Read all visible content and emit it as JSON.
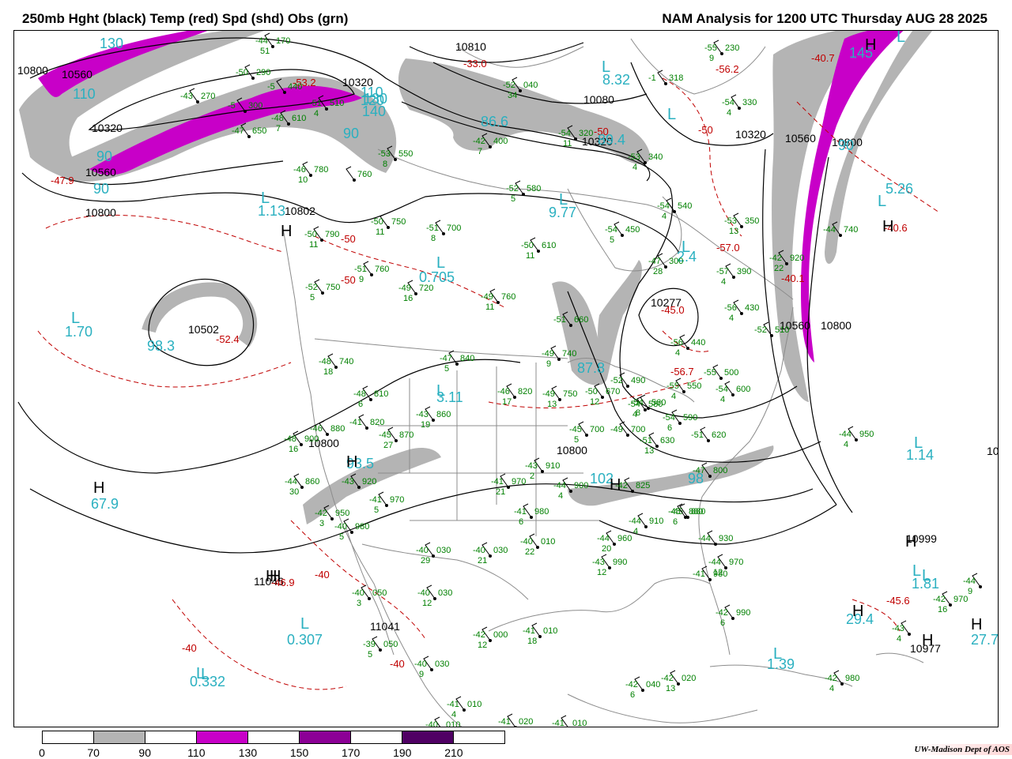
{
  "header": {
    "left_title": "250mb Hght (black) Temp (red) Spd (shd) Obs (grn)",
    "right_title": "NAM Analysis for 1200 UTC Thursday  AUG 28 2025"
  },
  "colors": {
    "height": "#000000",
    "temp": "#c00000",
    "obs": "#008000",
    "speed_label": "#2ab0c0",
    "shade_70": "#b4b4b4",
    "shade_110": "#c800c8",
    "shade_150": "#8c0096",
    "shade_190": "#500064",
    "map_lines": "#8c8c8c"
  },
  "colorbar": {
    "ticks": [
      "0",
      "70",
      "90",
      "110",
      "130",
      "150",
      "170",
      "190",
      "210"
    ],
    "fills": [
      "#ffffff",
      "#b4b4b4",
      "#ffffff",
      "#c800c8",
      "#ffffff",
      "#8c0096",
      "#ffffff",
      "#500064",
      "#ffffff"
    ]
  },
  "credit": "UW-Madison  Dept of AOS",
  "height_labels": [
    {
      "text": "10800",
      "name": "height-10800-nw"
    },
    {
      "text": "10560",
      "name": "height-10560-nw"
    },
    {
      "text": "10320",
      "name": "height-10320-nw"
    },
    {
      "text": "10560",
      "name": "height-10560-west"
    },
    {
      "text": "10800",
      "name": "height-10800-west"
    },
    {
      "text": "10320",
      "name": "height-10320-bc"
    },
    {
      "text": "10802",
      "name": "height-10802"
    },
    {
      "text": "10502",
      "name": "height-10502-low"
    },
    {
      "text": "10800",
      "name": "height-10800-sw"
    },
    {
      "text": "11046",
      "name": "height-11046"
    },
    {
      "text": "11041",
      "name": "height-11041"
    },
    {
      "text": "10810",
      "name": "height-10810-arctic"
    },
    {
      "text": "10080",
      "name": "height-10080-hudson"
    },
    {
      "text": "10320",
      "name": "height-10320-hudson"
    },
    {
      "text": "10277",
      "name": "height-10277"
    },
    {
      "text": "10560",
      "name": "height-10560-ne"
    },
    {
      "text": "10800",
      "name": "height-10800-ne"
    },
    {
      "text": "10320",
      "name": "height-10320-ne"
    },
    {
      "text": "10560",
      "name": "height-10560-atl"
    },
    {
      "text": "10800",
      "name": "height-10800-atl"
    },
    {
      "text": "10800",
      "name": "height-10800-ohio"
    },
    {
      "text": "10999",
      "name": "height-10999"
    },
    {
      "text": "10977",
      "name": "height-10977"
    },
    {
      "text": "10",
      "name": "height-10-edge"
    }
  ],
  "temp_labels": [
    {
      "text": "-47.9"
    },
    {
      "text": "-53.2"
    },
    {
      "text": "-50"
    },
    {
      "text": "-50"
    },
    {
      "text": "-52.4"
    },
    {
      "text": "-33.0"
    },
    {
      "text": "-50"
    },
    {
      "text": "-56.2"
    },
    {
      "text": "-40.7"
    },
    {
      "text": "-50"
    },
    {
      "text": "-40.6"
    },
    {
      "text": "-57.0"
    },
    {
      "text": "-40.1"
    },
    {
      "text": "-45.0"
    },
    {
      "text": "-56.7"
    },
    {
      "text": "-40"
    },
    {
      "text": "-40"
    },
    {
      "text": "-46.9"
    },
    {
      "text": "-40"
    },
    {
      "text": "-45.6"
    }
  ],
  "speed_labels": [
    {
      "text": "130"
    },
    {
      "text": "110"
    },
    {
      "text": "90"
    },
    {
      "text": "90"
    },
    {
      "text": "130"
    },
    {
      "text": "90"
    },
    {
      "text": "110"
    },
    {
      "text": "120"
    },
    {
      "text": "86.6"
    },
    {
      "text": "89.4"
    },
    {
      "text": "8.32"
    },
    {
      "text": "1.13"
    },
    {
      "text": "9.77"
    },
    {
      "text": "0.705"
    },
    {
      "text": "1.70"
    },
    {
      "text": "98.3"
    },
    {
      "text": "3.11"
    },
    {
      "text": "87.8"
    },
    {
      "text": "2.4"
    },
    {
      "text": "93.5"
    },
    {
      "text": "67.9"
    },
    {
      "text": "102"
    },
    {
      "text": "98"
    },
    {
      "text": "145"
    },
    {
      "text": "5.26"
    },
    {
      "text": "1.14"
    },
    {
      "text": "1.81"
    },
    {
      "text": "29.4"
    },
    {
      "text": "27.7"
    },
    {
      "text": "0.307"
    },
    {
      "text": "0.332"
    },
    {
      "text": "1.39"
    },
    {
      "text": "90"
    },
    {
      "text": "140"
    }
  ],
  "pressure_letters": [
    {
      "text": "L"
    },
    {
      "text": "L"
    },
    {
      "text": "L"
    },
    {
      "text": "L"
    },
    {
      "text": "L"
    },
    {
      "text": "L"
    },
    {
      "text": "H"
    },
    {
      "text": "L"
    },
    {
      "text": "H"
    },
    {
      "text": "L"
    },
    {
      "text": "L"
    },
    {
      "text": "L"
    },
    {
      "text": "H"
    },
    {
      "text": "H"
    },
    {
      "text": "L"
    },
    {
      "text": "H"
    },
    {
      "text": "H"
    },
    {
      "text": "H"
    },
    {
      "text": "H"
    },
    {
      "text": "L"
    },
    {
      "text": "H"
    },
    {
      "text": "L"
    },
    {
      "text": "L"
    },
    {
      "text": "L"
    },
    {
      "text": "H"
    },
    {
      "text": "H"
    },
    {
      "text": "H"
    },
    {
      "text": "L"
    },
    {
      "text": "L"
    }
  ],
  "observations": [
    {
      "temp": "-44",
      "hgt": "170",
      "dew": "51"
    },
    {
      "temp": "-50",
      "hgt": "290",
      "dew": ""
    },
    {
      "temp": "-43",
      "hgt": "270",
      "dew": ""
    },
    {
      "temp": "-5",
      "hgt": "300",
      "dew": ""
    },
    {
      "temp": "-5",
      "hgt": "440",
      "dew": ""
    },
    {
      "temp": "-51",
      "hgt": "510",
      "dew": "4"
    },
    {
      "temp": "-48",
      "hgt": "610",
      "dew": "7"
    },
    {
      "temp": "-47",
      "hgt": "650",
      "dew": ""
    },
    {
      "temp": "-53",
      "hgt": "550",
      "dew": "8"
    },
    {
      "temp": "-46",
      "hgt": "780",
      "dew": "10"
    },
    {
      "temp": "",
      "hgt": "760",
      "dew": ""
    },
    {
      "temp": "-50",
      "hgt": "750",
      "dew": "11"
    },
    {
      "temp": "-51",
      "hgt": "700",
      "dew": "8"
    },
    {
      "temp": "-50",
      "hgt": "790",
      "dew": "11"
    },
    {
      "temp": "-51",
      "hgt": "760",
      "dew": "9"
    },
    {
      "temp": "-49",
      "hgt": "720",
      "dew": "16"
    },
    {
      "temp": "-52",
      "hgt": "750",
      "dew": "5"
    },
    {
      "temp": "-52",
      "hgt": "580",
      "dew": "5"
    },
    {
      "temp": "-50",
      "hgt": "610",
      "dew": "11"
    },
    {
      "temp": "-49",
      "hgt": "760",
      "dew": "11"
    },
    {
      "temp": "-51",
      "hgt": "660",
      "dew": ""
    },
    {
      "temp": "-49",
      "hgt": "740",
      "dew": "9"
    },
    {
      "temp": "-47",
      "hgt": "840",
      "dew": "5"
    },
    {
      "temp": "-48",
      "hgt": "740",
      "dew": "18"
    },
    {
      "temp": "-48",
      "hgt": "810",
      "dew": "6"
    },
    {
      "temp": "-46",
      "hgt": "820",
      "dew": "17"
    },
    {
      "temp": "-49",
      "hgt": "750",
      "dew": "13"
    },
    {
      "temp": "-50",
      "hgt": "670",
      "dew": "12"
    },
    {
      "temp": "-52",
      "hgt": "490",
      "dew": ""
    },
    {
      "temp": "-54",
      "hgt": "580",
      "dew": "4"
    },
    {
      "temp": "-43",
      "hgt": "860",
      "dew": "19"
    },
    {
      "temp": "-41",
      "hgt": "820",
      "dew": ""
    },
    {
      "temp": "-46",
      "hgt": "880",
      "dew": ""
    },
    {
      "temp": "-45",
      "hgt": "870",
      "dew": "27"
    },
    {
      "temp": "-48",
      "hgt": "900",
      "dew": "16"
    },
    {
      "temp": "-44",
      "hgt": "860",
      "dew": "30"
    },
    {
      "temp": "-43",
      "hgt": "920",
      "dew": ""
    },
    {
      "temp": "-41",
      "hgt": "970",
      "dew": "5"
    },
    {
      "temp": "-42",
      "hgt": "950",
      "dew": "3"
    },
    {
      "temp": "-40",
      "hgt": "980",
      "dew": "5"
    },
    {
      "temp": "-41",
      "hgt": "970",
      "dew": "21"
    },
    {
      "temp": "-43",
      "hgt": "910",
      "dew": "2"
    },
    {
      "temp": "-44",
      "hgt": "900",
      "dew": "4"
    },
    {
      "temp": "-45",
      "hgt": "700",
      "dew": "5"
    },
    {
      "temp": "-41",
      "hgt": "980",
      "dew": "6"
    },
    {
      "temp": "-40",
      "hgt": "030",
      "dew": "29"
    },
    {
      "temp": "-40",
      "hgt": "030",
      "dew": "21"
    },
    {
      "temp": "-40",
      "hgt": "010",
      "dew": "22"
    },
    {
      "temp": "-40",
      "hgt": "050",
      "dew": "3"
    },
    {
      "temp": "-40",
      "hgt": "030",
      "dew": "12"
    },
    {
      "temp": "-39",
      "hgt": "050",
      "dew": "5"
    },
    {
      "temp": "-40",
      "hgt": "030",
      "dew": "9"
    },
    {
      "temp": "-42",
      "hgt": "000",
      "dew": "12"
    },
    {
      "temp": "-41",
      "hgt": "010",
      "dew": "18"
    },
    {
      "temp": "-41",
      "hgt": "010",
      "dew": "4"
    },
    {
      "temp": "-40",
      "hgt": "010",
      "dew": ""
    },
    {
      "temp": "-41",
      "hgt": "020",
      "dew": ""
    },
    {
      "temp": "-41",
      "hgt": "010",
      "dew": ""
    },
    {
      "temp": "-42",
      "hgt": "400",
      "dew": "7"
    },
    {
      "temp": "-52",
      "hgt": "040",
      "dew": "34"
    },
    {
      "temp": "-54",
      "hgt": "320",
      "dew": "11"
    },
    {
      "temp": "-53",
      "hgt": "340",
      "dew": "4"
    },
    {
      "temp": "-54",
      "hgt": "540",
      "dew": "4"
    },
    {
      "temp": "-54",
      "hgt": "450",
      "dew": "5"
    },
    {
      "temp": "-55",
      "hgt": "230",
      "dew": "9"
    },
    {
      "temp": "-1",
      "hgt": "318",
      "dew": ""
    },
    {
      "temp": "-54",
      "hgt": "330",
      "dew": "4"
    },
    {
      "temp": "-53",
      "hgt": "350",
      "dew": "13"
    },
    {
      "temp": "-47",
      "hgt": "300",
      "dew": "28"
    },
    {
      "temp": "-57",
      "hgt": "390",
      "dew": "4"
    },
    {
      "temp": "-56",
      "hgt": "430",
      "dew": "4"
    },
    {
      "temp": "-52",
      "hgt": "510",
      "dew": ""
    },
    {
      "temp": "-56",
      "hgt": "440",
      "dew": "4"
    },
    {
      "temp": "-55",
      "hgt": "500",
      "dew": ""
    },
    {
      "temp": "-55",
      "hgt": "550",
      "dew": "4"
    },
    {
      "temp": "-54",
      "hgt": "600",
      "dew": "4"
    },
    {
      "temp": "-54",
      "hgt": "560",
      "dew": "8"
    },
    {
      "temp": "-54",
      "hgt": "590",
      "dew": "6"
    },
    {
      "temp": "-51",
      "hgt": "620",
      "dew": ""
    },
    {
      "temp": "-51",
      "hgt": "630",
      "dew": "13"
    },
    {
      "temp": "-49",
      "hgt": "700",
      "dew": ""
    },
    {
      "temp": "-47",
      "hgt": "800",
      "dew": ""
    },
    {
      "temp": "-42",
      "hgt": "920",
      "dew": "22"
    },
    {
      "temp": "-44",
      "hgt": "740",
      "dew": ""
    },
    {
      "temp": "-44",
      "hgt": "950",
      "dew": "4"
    },
    {
      "temp": "-42",
      "hgt": "825",
      "dew": ""
    },
    {
      "temp": "-45",
      "hgt": "880",
      "dew": ""
    },
    {
      "temp": "-45",
      "hgt": "880",
      "dew": "6"
    },
    {
      "temp": "-44",
      "hgt": "910",
      "dew": "4"
    },
    {
      "temp": "-44",
      "hgt": "960",
      "dew": "20"
    },
    {
      "temp": "-44",
      "hgt": "930",
      "dew": ""
    },
    {
      "temp": "-43",
      "hgt": "990",
      "dew": "12"
    },
    {
      "temp": "-44",
      "hgt": "970",
      "dew": "12"
    },
    {
      "temp": "-41",
      "hgt": "980",
      "dew": ""
    },
    {
      "temp": "-42",
      "hgt": "990",
      "dew": "6"
    },
    {
      "temp": "-42",
      "hgt": "970",
      "dew": "16"
    },
    {
      "temp": "-43",
      "hgt": "",
      "dew": "4"
    },
    {
      "temp": "-44",
      "hgt": "",
      "dew": "9"
    },
    {
      "temp": "-42",
      "hgt": "040",
      "dew": "6"
    },
    {
      "temp": "-42",
      "hgt": "020",
      "dew": "13"
    },
    {
      "temp": "-42",
      "hgt": "980",
      "dew": "4"
    }
  ]
}
